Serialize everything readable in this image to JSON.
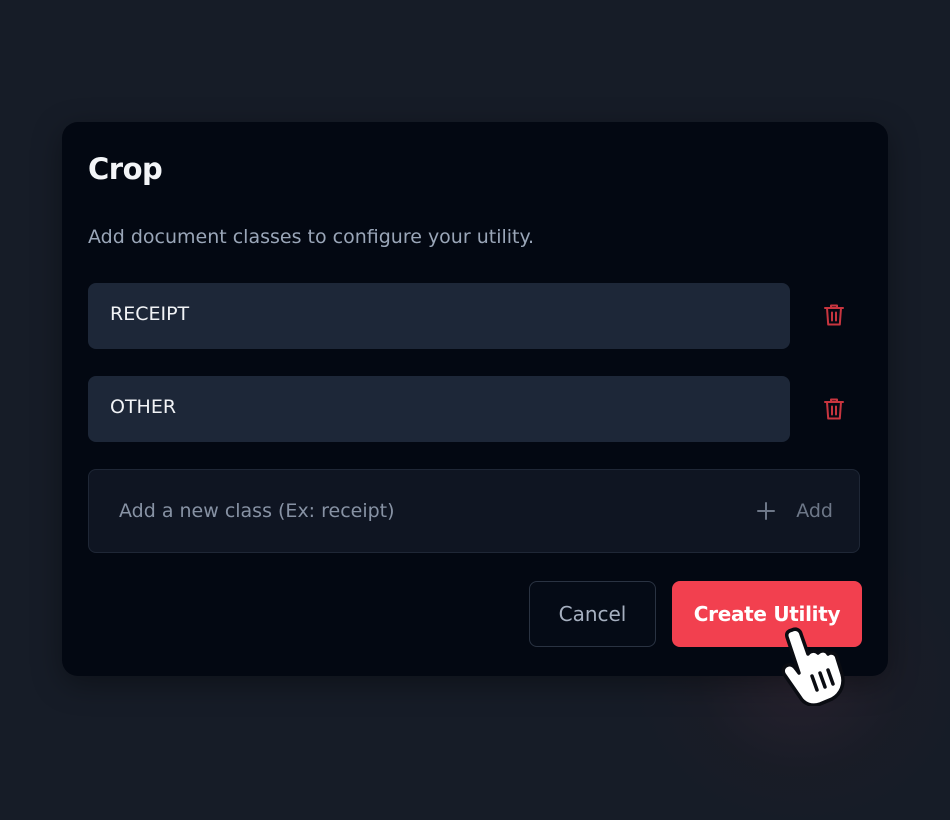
{
  "dialog": {
    "title": "Crop",
    "subtitle": "Add document classes to configure your utility.",
    "classes": [
      {
        "label": "RECEIPT",
        "delete_icon": "trash-icon"
      },
      {
        "label": "OTHER",
        "delete_icon": "trash-icon"
      }
    ],
    "new_class": {
      "placeholder": "Add a new class (Ex: receipt)",
      "value": "",
      "add_icon": "plus-icon",
      "add_label": "Add"
    },
    "buttons": {
      "cancel_label": "Cancel",
      "create_label": "Create Utility"
    }
  },
  "colors": {
    "background": "#161c27",
    "dialog": "#030812",
    "input_row": "#1d2738",
    "accent": "#f2404f",
    "delete_icon": "#c8353f",
    "muted_text": "#9aa6b8"
  },
  "pointer": {
    "icon": "hand-pointer-icon"
  }
}
